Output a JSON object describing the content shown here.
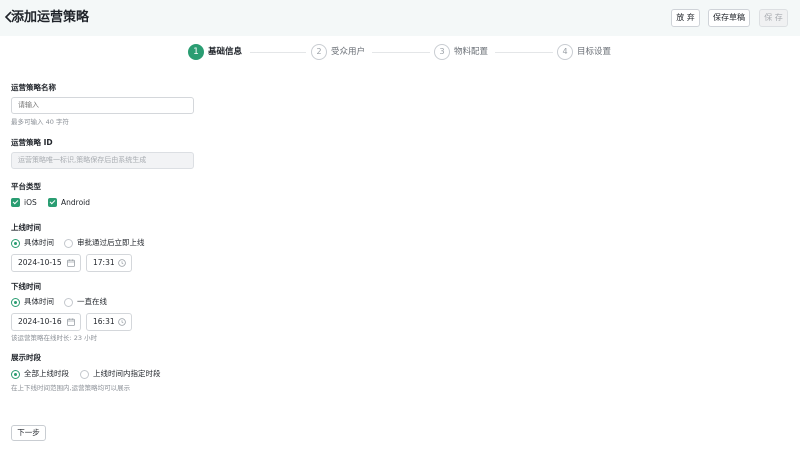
{
  "header": {
    "title": "添加运营策略",
    "discard_label": "放 弃",
    "save_draft_label": "保存草稿",
    "save_label": "保 存"
  },
  "steps": [
    {
      "num": "1",
      "label": "基础信息",
      "active": true
    },
    {
      "num": "2",
      "label": "受众用户",
      "active": false
    },
    {
      "num": "3",
      "label": "物料配置",
      "active": false
    },
    {
      "num": "4",
      "label": "目标设置",
      "active": false
    }
  ],
  "form": {
    "name": {
      "label": "运营策略名称",
      "placeholder": "请输入",
      "hint": "最多可输入 40 字符"
    },
    "id": {
      "label": "运营策略 ID",
      "placeholder": "运营策略唯一标识,策略保存后由系统生成"
    },
    "platform": {
      "label": "平台类型",
      "options": [
        "iOS",
        "Android"
      ]
    },
    "online": {
      "label": "上线时间",
      "options": [
        "具体时间",
        "审批通过后立即上线"
      ],
      "date": "2024-10-15",
      "time": "17:31"
    },
    "offline": {
      "label": "下线时间",
      "options": [
        "具体时间",
        "一直在线"
      ],
      "date": "2024-10-16",
      "time": "16:31",
      "hint": "该运营策略在线时长: 23 小时"
    },
    "display": {
      "label": "展示时段",
      "options": [
        "全部上线时段",
        "上线时间内指定时段"
      ],
      "hint": "在上下线时间范围内,运营策略均可以展示"
    }
  },
  "footer": {
    "next_label": "下一步"
  },
  "colors": {
    "accent": "#2a9d72",
    "header_bg": "#f4f8f8"
  },
  "icons": [
    "chevron-left-icon",
    "calendar-icon",
    "clock-icon",
    "check-icon"
  ]
}
